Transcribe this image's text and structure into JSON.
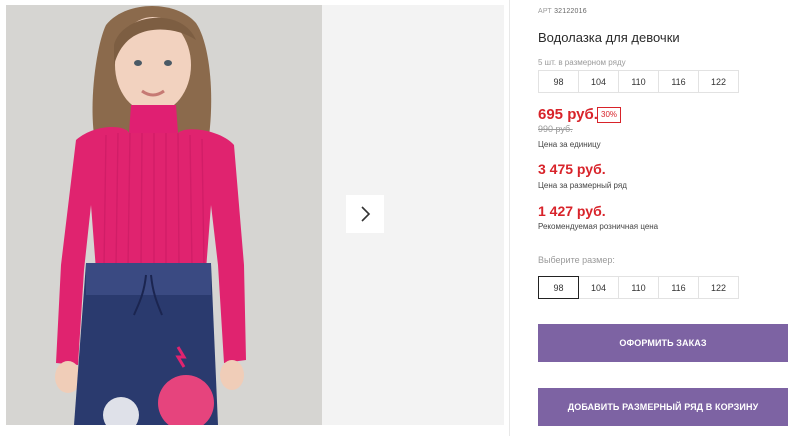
{
  "product": {
    "art_label": "АРТ",
    "art_number": "32122016",
    "title": "Водолазка для девочки",
    "pack_note": "5 шт. в размерном ряду"
  },
  "size_range": [
    "98",
    "104",
    "110",
    "116",
    "122"
  ],
  "prices": {
    "unit_price": "695 руб.",
    "discount": "30%",
    "old_price": "990 руб.",
    "unit_label": "Цена за единицу",
    "range_price": "3 475 руб.",
    "range_label": "Цена за размерный ряд",
    "retail_price": "1 427 руб.",
    "retail_label": "Рекомендуемая розничная цена"
  },
  "size_select": {
    "label": "Выберите размер:",
    "options": [
      "98",
      "104",
      "110",
      "116",
      "122"
    ],
    "selected": "98"
  },
  "buttons": {
    "order": "ОФОРМИТЬ ЗАКАЗ",
    "add_range": "ДОБАВИТЬ РАЗМЕРНЫЙ РЯД В КОРЗИНУ"
  },
  "gallery": {
    "next_icon": "chevron-right-icon"
  },
  "colors": {
    "price_red": "#d8232a",
    "button_purple": "#7d63a3"
  }
}
